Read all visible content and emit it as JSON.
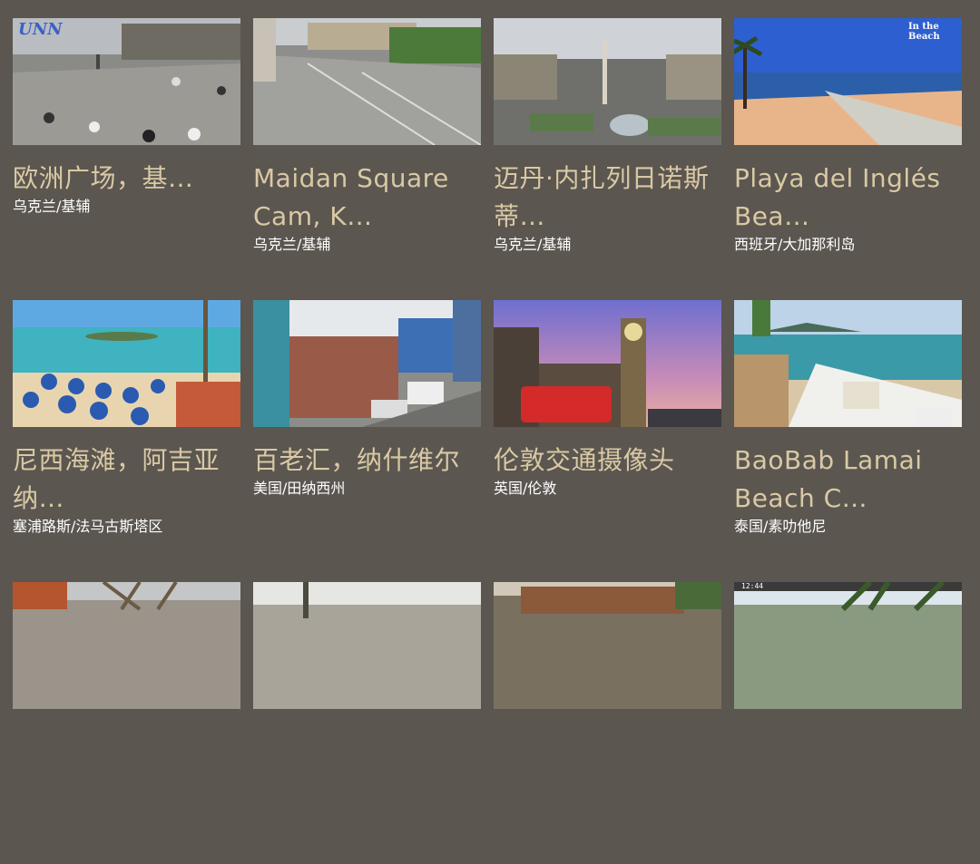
{
  "cards": [
    {
      "title": "欧洲广场，基…",
      "location": "乌克兰/基辅",
      "logo": "UNN"
    },
    {
      "title": "Maidan Square Cam, K…",
      "location": "乌克兰/基辅"
    },
    {
      "title": "迈丹·内扎列日诺斯蒂…",
      "location": "乌克兰/基辅"
    },
    {
      "title": "Playa del Inglés Bea…",
      "location": "西班牙/大加那利岛",
      "logo": "In the Beach"
    },
    {
      "title": "尼西海滩，阿吉亚纳…",
      "location": "塞浦路斯/法马古斯塔区"
    },
    {
      "title": "百老汇，纳什维尔",
      "location": "美国/田纳西州"
    },
    {
      "title": "伦敦交通摄像头",
      "location": "英国/伦敦"
    },
    {
      "title": "BaoBab Lamai Beach C…",
      "location": "泰国/素叻他尼"
    },
    {
      "title": "",
      "location": ""
    },
    {
      "title": "",
      "location": ""
    },
    {
      "title": "",
      "location": ""
    },
    {
      "title": "",
      "location": "",
      "overlay": "12:44"
    }
  ]
}
